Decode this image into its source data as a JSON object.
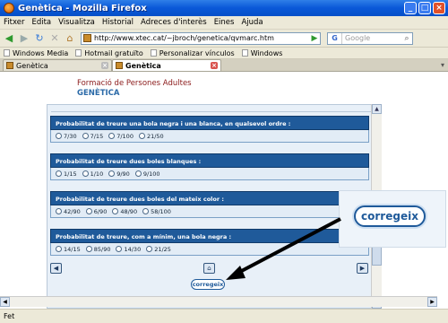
{
  "window": {
    "title": "Genètica - Mozilla Firefox",
    "buttons": {
      "minimize": "_",
      "maximize": "□",
      "close": "×"
    }
  },
  "menu": [
    "Fitxer",
    "Edita",
    "Visualitza",
    "Historial",
    "Adreces d'interès",
    "Eines",
    "Ajuda"
  ],
  "nav": {
    "url": "http://www.xtec.cat/~jbroch/genetica/qvmarc.htm",
    "search_placeholder": "Google",
    "search_engine": "G"
  },
  "bookmarks": [
    "Windows Media",
    "Hotmail gratuïto",
    "Personalizar vínculos",
    "Windows"
  ],
  "tabs": [
    {
      "label": "Genètica",
      "active": false
    },
    {
      "label": "Genètica",
      "active": true
    }
  ],
  "page": {
    "header_line1": "Formació de Persones Adultes",
    "header_line2": "GENÈTICA",
    "questions": [
      {
        "text": "Probabilitat de treure una bola negra i una blanca, en qualsevol ordre :",
        "options": [
          "7/30",
          "7/15",
          "7/100",
          "21/50"
        ]
      },
      {
        "text": "Probabilitat de treure dues boles blanques :",
        "options": [
          "1/15",
          "1/10",
          "9/90",
          "9/100"
        ]
      },
      {
        "text": "Probabilitat de treure dues boles del mateix color :",
        "options": [
          "42/90",
          "6/90",
          "48/90",
          "58/100"
        ]
      },
      {
        "text": "Probabilitat de treure, com a mínim, una bola negra :",
        "options": [
          "14/15",
          "85/90",
          "14/30",
          "21/25"
        ]
      }
    ],
    "correct_button": "corregeix",
    "correct_button_zoom": "corregeix"
  },
  "status": "Fet"
}
